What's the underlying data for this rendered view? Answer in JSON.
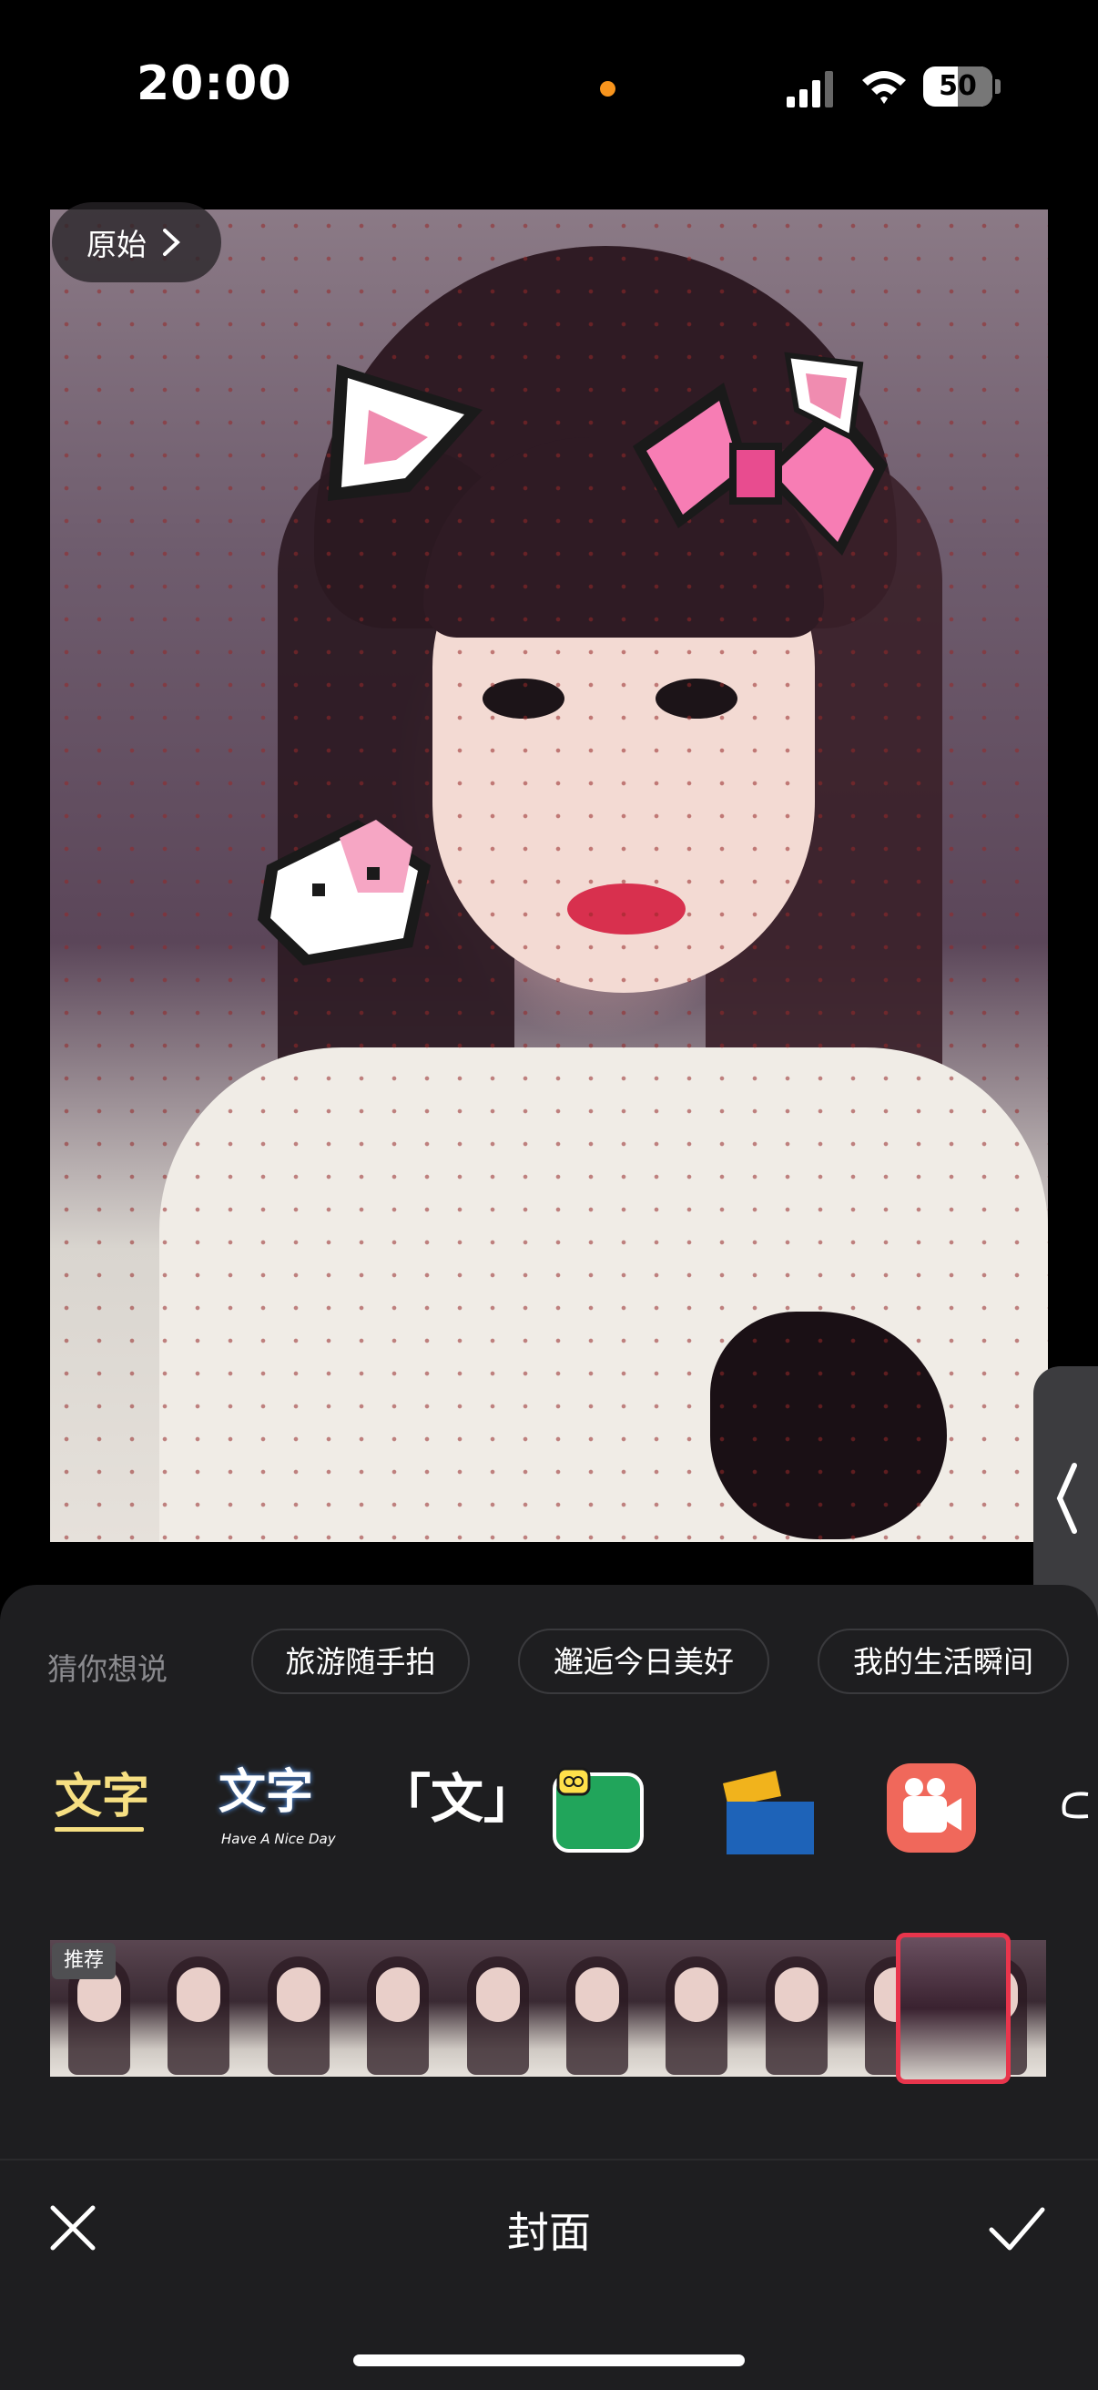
{
  "status": {
    "time": "20:00",
    "battery": "50",
    "accent_dot_color": "#f7941d"
  },
  "photo": {
    "original_label": "原始"
  },
  "suggestions": {
    "label": "猜你想说",
    "chips": [
      "旅游随手拍",
      "邂逅今日美好",
      "我的生活瞬间"
    ]
  },
  "text_styles": {
    "style1": "文字",
    "style2": "文字",
    "style2_sub": "Have A Nice Day",
    "style3": "「文」"
  },
  "filmstrip": {
    "badge": "推荐",
    "selected_color": "#e8354c"
  },
  "bottom_bar": {
    "title": "封面"
  },
  "icons": [
    "chevron-right-icon",
    "chevron-left-icon",
    "close-icon",
    "checkmark-icon",
    "wifi-icon",
    "cellular-icon"
  ]
}
